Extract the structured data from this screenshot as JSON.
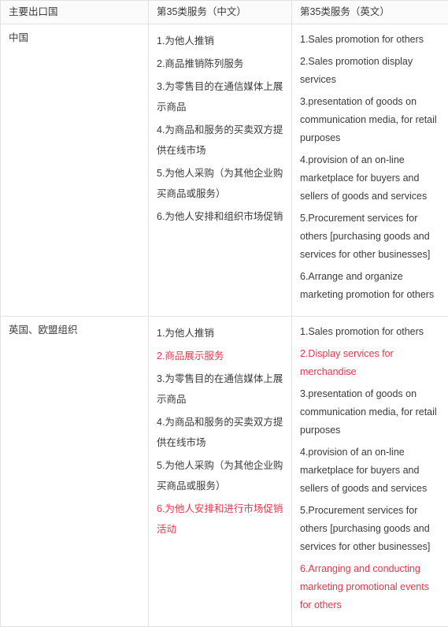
{
  "table": {
    "columns": [
      {
        "key": "country",
        "label": "主要出口国"
      },
      {
        "key": "services_zh",
        "label": "第35类服务（中文）"
      },
      {
        "key": "services_en",
        "label": "第35类服务（英文）"
      }
    ],
    "highlight_color": "#e8364a",
    "text_color": "#3a3a3a",
    "border_color": "#e3e3e3",
    "header_background": "#fbfbfb",
    "rows": [
      {
        "country": "中国",
        "services_zh": [
          {
            "text": "1.为他人推销",
            "highlight": false
          },
          {
            "text": "2.商品推销陈列服务",
            "highlight": false
          },
          {
            "text": "3.为零售目的在通信媒体上展示商品",
            "highlight": false
          },
          {
            "text": "4.为商品和服务的买卖双方提供在线市场",
            "highlight": false
          },
          {
            "text": "5.为他人采购（为其他企业购买商品或服务）",
            "highlight": false
          },
          {
            "text": "6.为他人安排和组织市场促销",
            "highlight": false
          }
        ],
        "services_en": [
          {
            "text": "1.Sales promotion for others",
            "highlight": false
          },
          {
            "text": "2.Sales promotion display services",
            "highlight": false
          },
          {
            "text": "3.presentation of goods on communication media, for retail purposes",
            "highlight": false
          },
          {
            "text": "4.provision of an on-line marketplace for buyers and sellers of goods and services",
            "highlight": false
          },
          {
            "text": "5.Procurement services for others [purchasing goods and services for other businesses]",
            "highlight": false
          },
          {
            "text": "6.Arrange and organize marketing promotion for others",
            "highlight": false
          }
        ]
      },
      {
        "country": "英国、欧盟组织",
        "services_zh": [
          {
            "text": "1.为他人推销",
            "highlight": false
          },
          {
            "text": "2.商品展示服务",
            "highlight": true
          },
          {
            "text": "3.为零售目的在通信媒体上展示商品",
            "highlight": false
          },
          {
            "text": "4.为商品和服务的买卖双方提供在线市场",
            "highlight": false
          },
          {
            "text": "5.为他人采购（为其他企业购买商品或服务）",
            "highlight": false
          },
          {
            "text": "6.为他人安排和进行市场促销活动",
            "highlight": true
          }
        ],
        "services_en": [
          {
            "text": "1.Sales promotion for others",
            "highlight": false
          },
          {
            "text": "2.Display services for merchandise",
            "highlight": true
          },
          {
            "text": "3.presentation of goods on communication media, for retail purposes",
            "highlight": false
          },
          {
            "text": "4.provision of an on-line marketplace for buyers and sellers of goods and services",
            "highlight": false
          },
          {
            "text": "5.Procurement services for others [purchasing goods and services for other businesses]",
            "highlight": false
          },
          {
            "text": "6.Arranging and conducting marketing promotional events for others",
            "highlight": true
          }
        ]
      }
    ]
  }
}
